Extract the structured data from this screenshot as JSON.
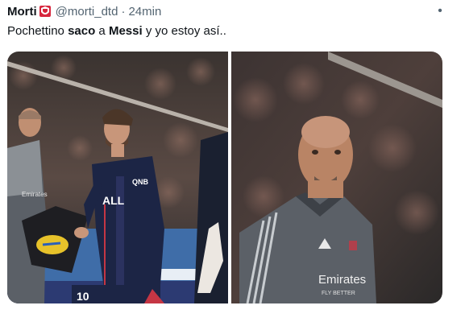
{
  "tweet": {
    "author_name": "Morti",
    "author_handle": "@morti_dtd",
    "separator": "·",
    "timestamp": "24min",
    "text_pre": "Pochettino ",
    "text_bold_1": "saco",
    "text_mid": " a ",
    "text_bold_2": "Messi",
    "text_post": " y yo estoy así..",
    "menu_glyph": "•"
  },
  "media": {
    "left_image": {
      "jersey_sponsor": "QNB",
      "jersey_brand": "ALL",
      "trainer_sponsor": "Emirates"
    },
    "right_image": {
      "trainer_sponsor": "Emirates",
      "trainer_sponsor_line2": "FLY BETTER"
    }
  },
  "colors": {
    "badge_red": "#d7263d",
    "psg_navy": "#1c2545",
    "grey_jacket": "#5b6067"
  }
}
